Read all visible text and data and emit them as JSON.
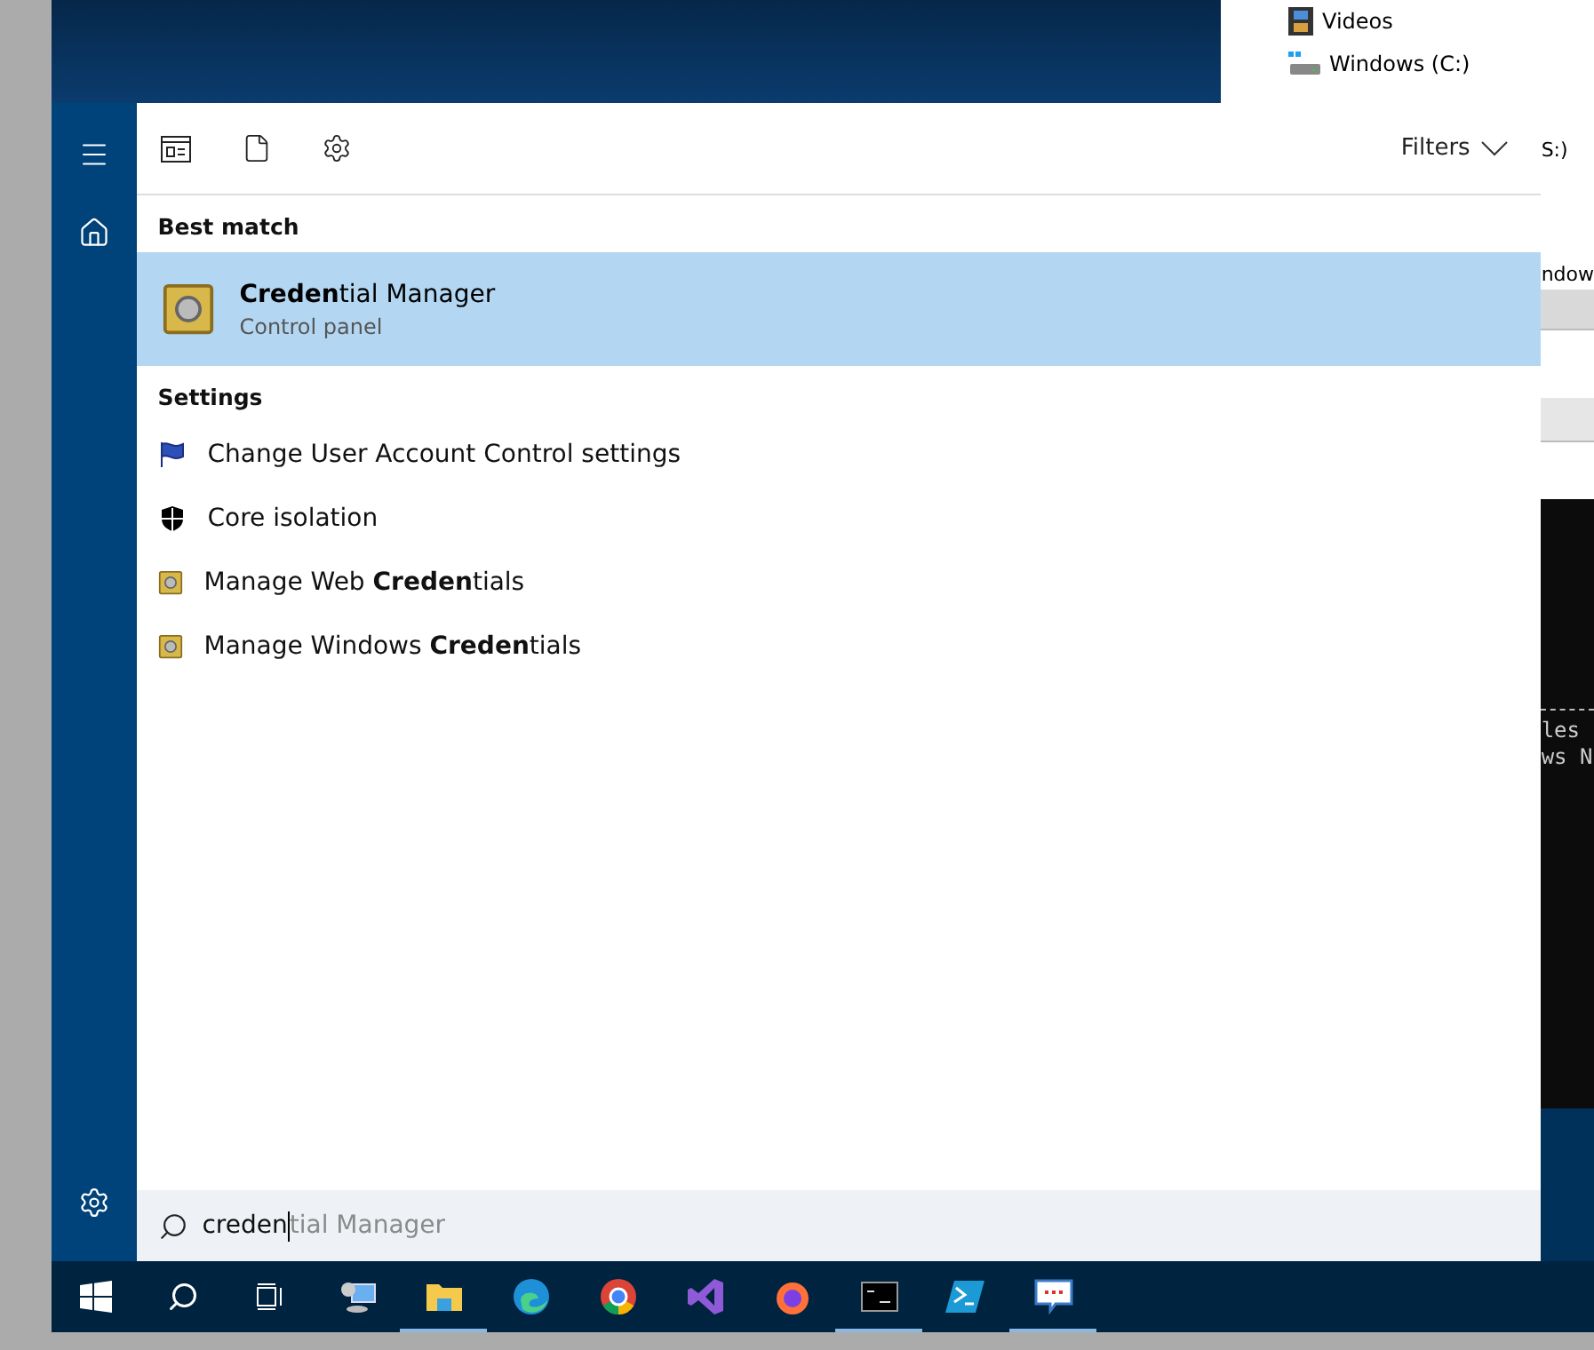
{
  "desktop": {
    "explorer_items": [
      {
        "label": "Videos",
        "kind": "videos"
      },
      {
        "label": "Windows (C:)",
        "kind": "drive"
      }
    ],
    "background_fragments": [
      {
        "text": "S:)",
        "kind": "text"
      },
      {
        "text": "ndow",
        "kind": "text"
      },
      {
        "text": "les",
        "kind": "console"
      },
      {
        "text": "ws N",
        "kind": "console"
      }
    ]
  },
  "start": {
    "toolbar": {
      "filters": "Filters"
    },
    "best_match": {
      "heading": "Best match",
      "title": "**Creden**tial Manager",
      "subtitle": "Control panel",
      "selected": true
    },
    "settings": {
      "heading": "Settings",
      "items": [
        {
          "label": "Change User Account Control settings",
          "kind": "flag"
        },
        {
          "label": "Core isolation",
          "kind": "shield"
        },
        {
          "label": "Manage Web **Creden**tials",
          "kind": "safe"
        },
        {
          "label": "Manage Windows **Creden**tials",
          "kind": "safe"
        }
      ]
    },
    "search": {
      "value": "creden",
      "suggestion": "tial Manager"
    }
  },
  "taskbar": [
    {
      "kind": "start",
      "running": false
    },
    {
      "kind": "search",
      "running": false
    },
    {
      "kind": "taskview",
      "running": false
    },
    {
      "kind": "network",
      "running": false
    },
    {
      "kind": "folder",
      "running": true
    },
    {
      "kind": "edge",
      "running": false
    },
    {
      "kind": "chrome",
      "running": false
    },
    {
      "kind": "vs",
      "running": false
    },
    {
      "kind": "firefox",
      "running": false
    },
    {
      "kind": "cmd",
      "running": true
    },
    {
      "kind": "powershell",
      "running": false
    },
    {
      "kind": "feedback",
      "running": true
    }
  ]
}
